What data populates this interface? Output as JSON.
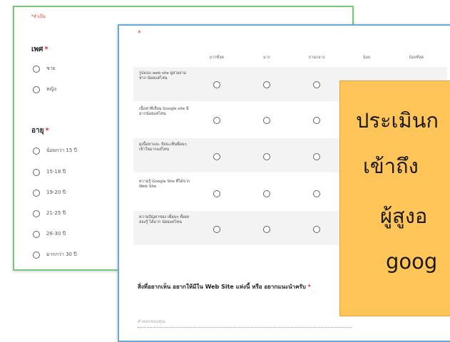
{
  "back_form": {
    "required_note": "*จำเป็น",
    "gender": {
      "label": "เพศ",
      "options": [
        "ชาย",
        "หญิง"
      ]
    },
    "age": {
      "label": "อายุ",
      "options": [
        "น้อยกว่า 15 ปี",
        "15-18 ปี",
        "19-20 ปี",
        "21-25 ปี",
        "26-30 ปี",
        "มากกว่า 30 ปี"
      ]
    }
  },
  "front_form": {
    "required_mark": "*",
    "columns": [
      "มากที่สุด",
      "มาก",
      "ปานกลาง",
      "น้อย",
      "น้อยที่สุด"
    ],
    "rows": [
      "รูปแบบ web site ดูสวยงามหาก น้อยแค่ไหน",
      "เนื้อหาที่เสื่อม Google site มี มากน้อยแค่ไหน",
      "ดูเนื้อหาและ ปัจจะเห็นพื่อนๆ เข้าใจมากแค่ไหน",
      "ความรู้ Google Site ที่ได้จาก Web Site",
      "ความปัญหาของ เพื่อนๆ ทั้งผลลองรู้ ได้มาก น้อยแค่ไหน"
    ],
    "question2": "สิ่งที่อยากเห็น อยากให้มีใน Web Site แห่งนี้ หรือ อยากแนะนำครับ",
    "question2_star": "*",
    "answer_placeholder": "คำตอบของคุณ"
  },
  "overlay": {
    "lines": [
      "ประเมินก",
      "เข้าถึง",
      "ผู้สูงอ",
      "goog"
    ]
  },
  "colors": {
    "back_border": "#7bc67e",
    "front_border": "#6aa8d8",
    "overlay_fill": "#ffc559",
    "required": "#d93025"
  }
}
